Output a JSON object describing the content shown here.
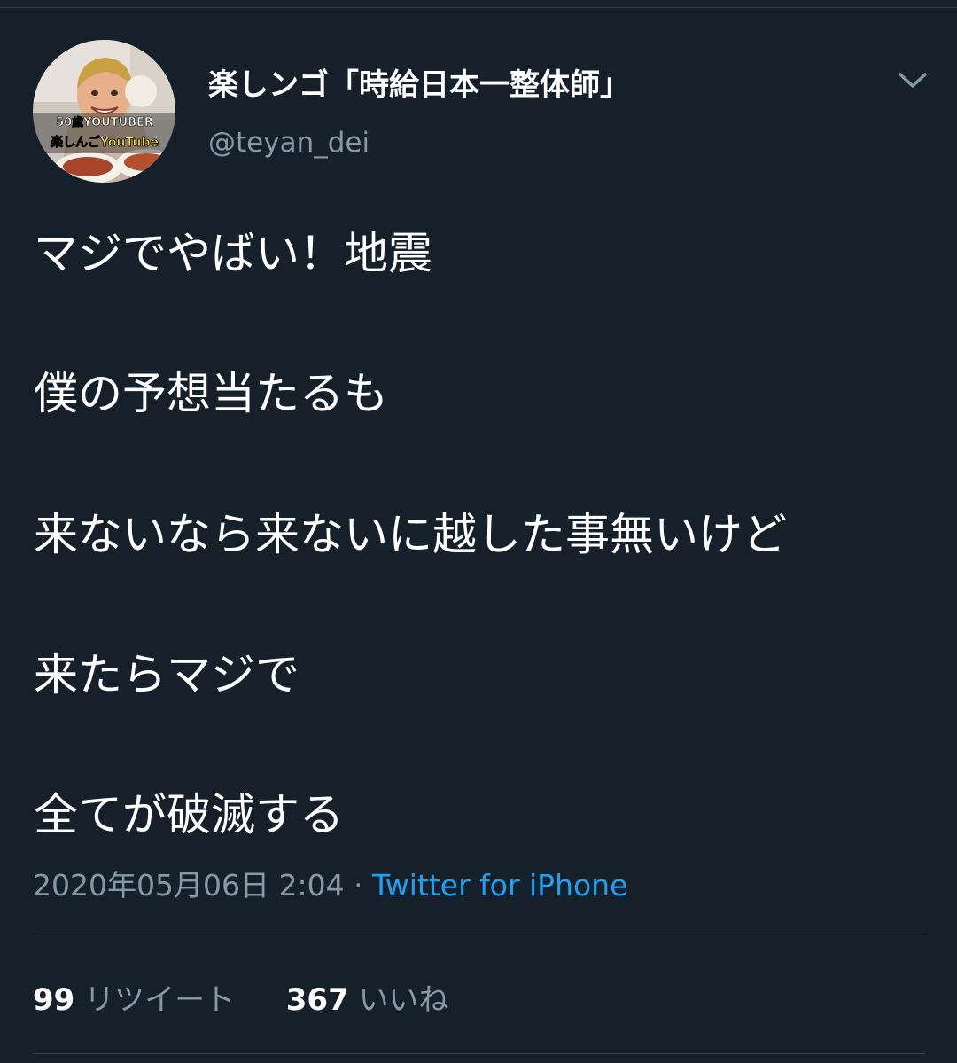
{
  "tweet": {
    "display_name": "楽しンゴ「時給日本一整体師」",
    "handle": "@teyan_dei",
    "avatar": {
      "caption_top": "50歳YOUTUBER",
      "caption_bottom": "楽しんごYouTube"
    },
    "text_lines": [
      "マジでやばい！地震",
      "僕の予想当たるも",
      "来ないなら来ないに越した事無いけど",
      "来たらマジで",
      "全てが破滅する"
    ],
    "timestamp": "2020年05月06日 2:04",
    "separator": " · ",
    "source": "Twitter for iPhone",
    "retweet_count": "99",
    "retweet_label": "リツイート",
    "like_count": "367",
    "like_label": "いいね"
  },
  "icons": {
    "more": "chevron-down-icon"
  },
  "colors": {
    "background": "#15202b",
    "primary_text": "#ffffff",
    "secondary_text": "#8899a6",
    "link": "#1da1f2",
    "divider": "#38444d"
  }
}
